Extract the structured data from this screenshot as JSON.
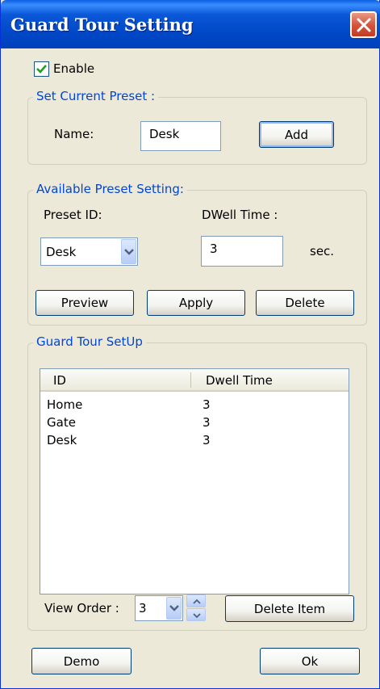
{
  "window": {
    "title": "Guard Tour Setting"
  },
  "enable": {
    "label": "Enable",
    "checked": true
  },
  "current_preset": {
    "legend": "Set Current Preset :",
    "name_label": "Name:",
    "name_value": "Desk",
    "add_label": "Add"
  },
  "available_preset": {
    "legend": "Available Preset Setting:",
    "preset_id_label": "Preset ID:",
    "dwell_time_label": "DWell Time :",
    "preset_id_value": "Desk",
    "dwell_time_value": "3",
    "sec_label": "sec.",
    "preview_label": "Preview",
    "apply_label": "Apply",
    "delete_label": "Delete"
  },
  "guard_tour": {
    "legend": "Guard Tour SetUp",
    "columns": [
      "ID",
      "Dwell Time"
    ],
    "rows": [
      {
        "id": "Home",
        "dwell": "3"
      },
      {
        "id": "Gate",
        "dwell": "3"
      },
      {
        "id": "Desk",
        "dwell": "3"
      }
    ],
    "view_order_label": "View Order :",
    "view_order_value": "3",
    "delete_item_label": "Delete Item"
  },
  "footer": {
    "demo_label": "Demo",
    "ok_label": "Ok"
  },
  "colors": {
    "title_bar": "#0047c6",
    "legend_text": "#0046d5",
    "close_button": "#d2523a",
    "window_bg": "#ece9d8"
  },
  "icons": {
    "close": "close-icon",
    "check": "checkmark-icon",
    "dropdown": "chevron-down-icon",
    "spin_up": "chevron-up-icon",
    "spin_down": "chevron-down-icon"
  }
}
